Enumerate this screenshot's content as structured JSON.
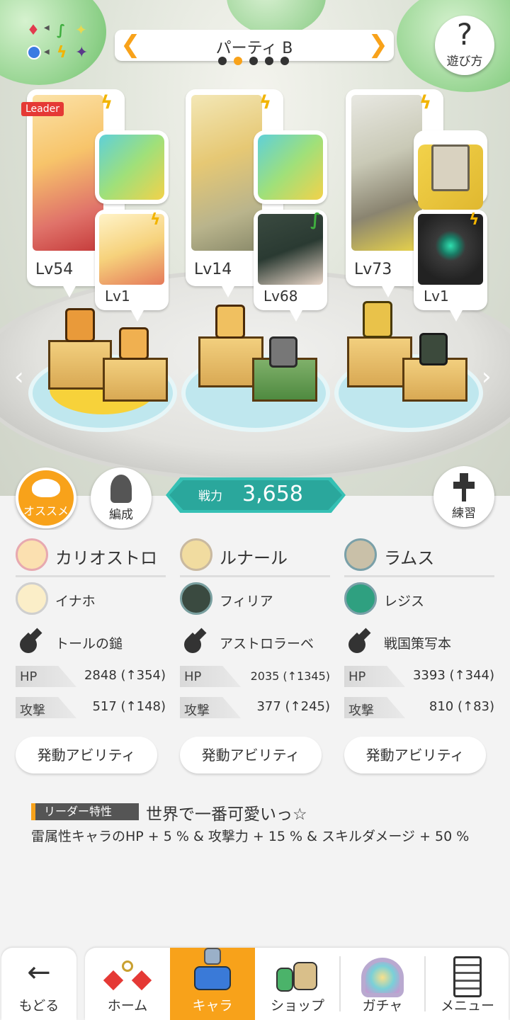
{
  "header": {
    "party_title": "パーティ B",
    "page_dots": 5,
    "active_dot": 1,
    "help_label": "遊び方",
    "help_icon": "?"
  },
  "team": [
    {
      "leader_badge": "Leader",
      "main_level": "Lv54",
      "sub_level": "Lv1",
      "main_element": "thunder",
      "sub_element": "thunder",
      "weapon_icon": "hammer-icon"
    },
    {
      "leader_badge": "",
      "main_level": "Lv14",
      "sub_level": "Lv68",
      "main_element": "thunder",
      "sub_element": "wind",
      "weapon_icon": "astrolabe-icon"
    },
    {
      "leader_badge": "",
      "main_level": "Lv73",
      "sub_level": "Lv1",
      "main_element": "thunder",
      "sub_element": "thunder",
      "weapon_icon": "book-icon"
    }
  ],
  "left_buttons": {
    "recommend": "オススメ",
    "formation": "編成"
  },
  "power": {
    "label": "戦力",
    "value": "3,658"
  },
  "practice_label": "練習",
  "members": [
    {
      "name": "カリオストロ",
      "sub": "イナホ",
      "weapon": "トールの鎚",
      "hp": "2848 (↑354)",
      "atk": "517 (↑148)"
    },
    {
      "name": "ルナール",
      "sub": "フィリア",
      "weapon": "アストロラーベ",
      "hp": "2035 (↑1345)",
      "atk": "377 (↑245)"
    },
    {
      "name": "ラムス",
      "sub": "レジス",
      "weapon": "戦国策写本",
      "hp": "3393 (↑344)",
      "atk": "810 (↑83)"
    }
  ],
  "stat_labels": {
    "hp": "HP",
    "atk": "攻撃"
  },
  "ability_label": "発動アビリティ",
  "leader": {
    "tag": "リーダー特性",
    "title": "世界で一番可愛いっ☆",
    "desc": "雷属性キャラのHP + 5 % & 攻撃力 + 15 % & スキルダメージ + 50 %"
  },
  "nav": {
    "back": "もどる",
    "items": [
      "ホーム",
      "キャラ",
      "ショップ",
      "ガチャ",
      "メニュー"
    ],
    "active": 1
  },
  "colors": {
    "accent": "#f8a21a",
    "teal": "#35c0b4",
    "thunder": "#f2b400",
    "wind": "#3fae3f"
  }
}
